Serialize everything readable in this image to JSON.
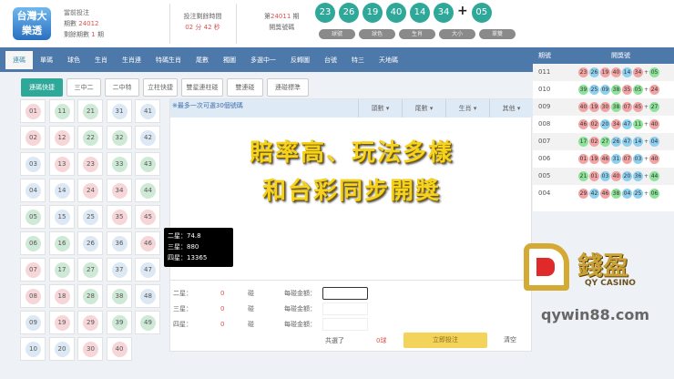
{
  "header": {
    "logo_text": "台灣大樂透",
    "current_label": "當前投注",
    "period_label": "期數",
    "period": "24012",
    "remaining_label": "剩餘期數",
    "remaining": "1",
    "remaining_unit": "期",
    "time_label": "投注剩餘時間",
    "minutes": "02",
    "min_unit": "分",
    "seconds": "42",
    "sec_unit": "秒",
    "draw_prefix": "第",
    "draw_period": "24011",
    "draw_suffix": "期",
    "draw_label": "開獎號碼",
    "draw_balls": [
      "23",
      "26",
      "19",
      "40",
      "14",
      "34"
    ],
    "draw_special": "05",
    "plus": "+",
    "draw_buttons": [
      "球號",
      "球色",
      "生肖",
      "大小",
      "單雙"
    ]
  },
  "nav": {
    "tabs": [
      "連碼",
      "單碼",
      "球色",
      "生肖",
      "生肖連",
      "特碼生肖",
      "尾數",
      "獨圖",
      "多選中一",
      "反轉圖",
      "台號",
      "特三",
      "天地碼"
    ],
    "active": 0
  },
  "sub_buttons": [
    "連碼快捷",
    "三中二",
    "二中特",
    "立柱快捷",
    "雙星連柱碰",
    "雙連碰",
    "連碰標準"
  ],
  "number_grid": [
    [
      "01",
      "11",
      "21",
      "31",
      "41"
    ],
    [
      "02",
      "12",
      "22",
      "32",
      "42"
    ],
    [
      "03",
      "13",
      "23",
      "33",
      "43"
    ],
    [
      "04",
      "14",
      "24",
      "34",
      "44"
    ],
    [
      "05",
      "15",
      "25",
      "35",
      "45"
    ],
    [
      "06",
      "16",
      "26",
      "36",
      "46"
    ],
    [
      "07",
      "17",
      "27",
      "37",
      "47"
    ],
    [
      "08",
      "18",
      "28",
      "38",
      "48"
    ],
    [
      "09",
      "19",
      "29",
      "39",
      "49"
    ],
    [
      "10",
      "20",
      "30",
      "40"
    ]
  ],
  "center": {
    "note": "※最多一次可選30個號碼",
    "dropdowns": [
      "頭數",
      "尾數",
      "生肖",
      "其他"
    ],
    "promo_line1": "賠率高、玩法多樣",
    "promo_line2": "和台彩同步開獎"
  },
  "tooltip": [
    "二星：74.8",
    "三星：880",
    "四星：13365"
  ],
  "form": {
    "rows": [
      {
        "label": "二星：",
        "count": "0",
        "unit": "碰",
        "amount_label": "每碰金額：",
        "value": ""
      },
      {
        "label": "三星：",
        "count": "0",
        "unit": "碰",
        "amount_label": "每碰金額：",
        "value": ""
      },
      {
        "label": "四星：",
        "count": "0",
        "unit": "碰",
        "amount_label": "每碰金額：",
        "value": ""
      }
    ],
    "total_label": "共選了",
    "total": "0球",
    "submit": "立即投注",
    "clear": "清空"
  },
  "history": {
    "col_period": "期號",
    "col_numbers": "開獎號",
    "rows": [
      {
        "p": "011",
        "n": [
          "23",
          "26",
          "19",
          "40",
          "14",
          "34"
        ],
        "s": "05"
      },
      {
        "p": "010",
        "n": [
          "39",
          "25",
          "09",
          "38",
          "35",
          "05"
        ],
        "s": "24"
      },
      {
        "p": "009",
        "n": [
          "40",
          "19",
          "30",
          "38",
          "07",
          "45"
        ],
        "s": "27"
      },
      {
        "p": "008",
        "n": [
          "46",
          "02",
          "20",
          "34",
          "47",
          "11"
        ],
        "s": "40"
      },
      {
        "p": "007",
        "n": [
          "17",
          "02",
          "27",
          "26",
          "47",
          "14"
        ],
        "s": "04"
      },
      {
        "p": "006",
        "n": [
          "01",
          "19",
          "46",
          "31",
          "07",
          "03"
        ],
        "s": "40"
      },
      {
        "p": "005",
        "n": [
          "21",
          "01",
          "03",
          "40",
          "20",
          "36"
        ],
        "s": "44"
      },
      {
        "p": "004",
        "n": [
          "29",
          "42",
          "46",
          "38",
          "04",
          "25"
        ],
        "s": "06"
      }
    ]
  },
  "watermark": {
    "brand_cn": "錢盈",
    "brand_en": "QY CASINO",
    "url": "qywin88.com"
  },
  "colors": {
    "teal": "#2fa89a",
    "nav": "#4d78aa",
    "red": "#f2a3a3",
    "blue": "#8fd0ef",
    "green": "#8ee29a"
  }
}
